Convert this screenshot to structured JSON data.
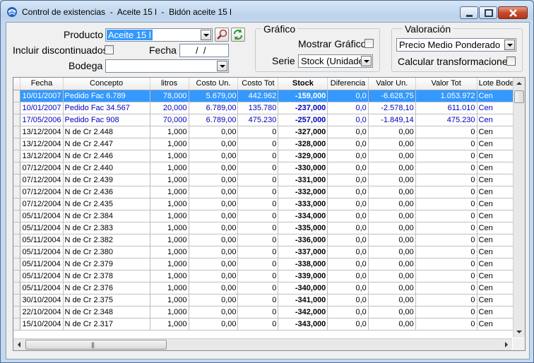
{
  "window": {
    "title": "Control de existencias  -  Aceite 15 l  -  Bidón aceite 15 l"
  },
  "form": {
    "producto_label": "Producto",
    "producto_value": "Aceite 15 l",
    "incluir_label": "Incluir discontinuados",
    "fecha_label": "Fecha",
    "fecha_value": "/  /",
    "bodega_label": "Bodega",
    "bodega_value": ""
  },
  "grafico": {
    "group_label": "Gráfico",
    "mostrar_label": "Mostrar Gráfico",
    "serie_label": "Serie",
    "serie_value": "Stock (Unidades)"
  },
  "valoracion": {
    "group_label": "Valoración",
    "metodo_value": "Precio Medio Ponderado",
    "calcular_label": "Calcular transformaciones"
  },
  "grid": {
    "columns": [
      "Fecha",
      "Concepto",
      "litros",
      "Costo Un.",
      "Costo Tot",
      "Stock",
      "Diferencia",
      "Valor Un.",
      "Valor Tot",
      "Lote Bodega"
    ],
    "rows": [
      [
        "10/01/2007",
        "Pedido Fac 6.789",
        "78,000",
        "5.679,00",
        "442.962",
        "-159,000",
        "0,0",
        "-6.628,75",
        "1.053.972",
        "Cen"
      ],
      [
        "10/01/2007",
        "Pedido Fac 34.567",
        "20,000",
        "6.789,00",
        "135.780",
        "-237,000",
        "0,0",
        "-2.578,10",
        "611.010",
        "Cen"
      ],
      [
        "17/05/2006",
        "Pedido Fac 908",
        "70,000",
        "6.789,00",
        "475.230",
        "-257,000",
        "0,0",
        "-1.849,14",
        "475.230",
        "Cen"
      ],
      [
        "13/12/2004",
        "N de Cr 2.448",
        "1,000",
        "0,00",
        "0",
        "-327,000",
        "0,0",
        "0,00",
        "0",
        "Cen"
      ],
      [
        "13/12/2004",
        "N de Cr 2.447",
        "1,000",
        "0,00",
        "0",
        "-328,000",
        "0,0",
        "0,00",
        "0",
        "Cen"
      ],
      [
        "13/12/2004",
        "N de Cr 2.446",
        "1,000",
        "0,00",
        "0",
        "-329,000",
        "0,0",
        "0,00",
        "0",
        "Cen"
      ],
      [
        "07/12/2004",
        "N de Cr 2.440",
        "1,000",
        "0,00",
        "0",
        "-330,000",
        "0,0",
        "0,00",
        "0",
        "Cen"
      ],
      [
        "07/12/2004",
        "N de Cr 2.439",
        "1,000",
        "0,00",
        "0",
        "-331,000",
        "0,0",
        "0,00",
        "0",
        "Cen"
      ],
      [
        "07/12/2004",
        "N de Cr 2.436",
        "1,000",
        "0,00",
        "0",
        "-332,000",
        "0,0",
        "0,00",
        "0",
        "Cen"
      ],
      [
        "07/12/2004",
        "N de Cr 2.435",
        "1,000",
        "0,00",
        "0",
        "-333,000",
        "0,0",
        "0,00",
        "0",
        "Cen"
      ],
      [
        "05/11/2004",
        "N de Cr 2.384",
        "1,000",
        "0,00",
        "0",
        "-334,000",
        "0,0",
        "0,00",
        "0",
        "Cen"
      ],
      [
        "05/11/2004",
        "N de Cr 2.383",
        "1,000",
        "0,00",
        "0",
        "-335,000",
        "0,0",
        "0,00",
        "0",
        "Cen"
      ],
      [
        "05/11/2004",
        "N de Cr 2.382",
        "1,000",
        "0,00",
        "0",
        "-336,000",
        "0,0",
        "0,00",
        "0",
        "Cen"
      ],
      [
        "05/11/2004",
        "N de Cr 2.380",
        "1,000",
        "0,00",
        "0",
        "-337,000",
        "0,0",
        "0,00",
        "0",
        "Cen"
      ],
      [
        "05/11/2004",
        "N de Cr 2.379",
        "1,000",
        "0,00",
        "0",
        "-338,000",
        "0,0",
        "0,00",
        "0",
        "Cen"
      ],
      [
        "05/11/2004",
        "N de Cr 2.378",
        "1,000",
        "0,00",
        "0",
        "-339,000",
        "0,0",
        "0,00",
        "0",
        "Cen"
      ],
      [
        "05/11/2004",
        "N de Cr 2.376",
        "1,000",
        "0,00",
        "0",
        "-340,000",
        "0,0",
        "0,00",
        "0",
        "Cen"
      ],
      [
        "30/10/2004",
        "N de Cr 2.375",
        "1,000",
        "0,00",
        "0",
        "-341,000",
        "0,0",
        "0,00",
        "0",
        "Cen"
      ],
      [
        "22/10/2004",
        "N de Cr 2.348",
        "1,000",
        "0,00",
        "0",
        "-342,000",
        "0,0",
        "0,00",
        "0",
        "Cen"
      ],
      [
        "15/10/2004",
        "N de Cr 2.317",
        "1,000",
        "0,00",
        "0",
        "-343,000",
        "0,0",
        "0,00",
        "0",
        "Cen"
      ]
    ]
  },
  "colors": {
    "selection": "#3399ff",
    "highlight_text": "#0000c0"
  },
  "icons": {
    "app": "app-swirl-icon",
    "search": "magnifier-icon",
    "refresh": "refresh-icon"
  }
}
